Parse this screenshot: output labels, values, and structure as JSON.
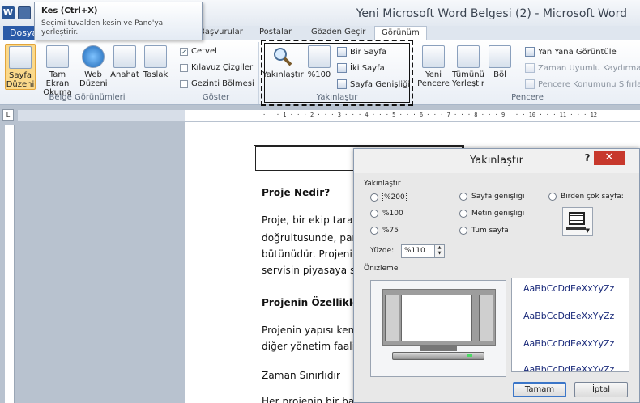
{
  "window": {
    "title": "Yeni Microsoft Word Belgesi (2)  -  Microsoft Word"
  },
  "tooltip": {
    "title": "Kes (Ctrl+X)",
    "body": "Seçimi tuvalden kesin ve Pano'ya yerleştirir."
  },
  "tabs": {
    "file": "Dosya",
    "items": [
      "Başvurular",
      "Postalar",
      "Gözden Geçir",
      "Görünüm"
    ],
    "active": "Görünüm"
  },
  "ribbon": {
    "belge_gorunumleri": {
      "label": "Belge Görünümleri",
      "buttons": [
        {
          "l1": "Sayfa",
          "l2": "Düzeni",
          "icon": "page-layout-icon"
        },
        {
          "l1": "Tam Ekran",
          "l2": "Okuma",
          "icon": "full-screen-reading-icon"
        },
        {
          "l1": "Web",
          "l2": "Düzeni",
          "icon": "web-layout-icon"
        },
        {
          "l1": "Anahat",
          "l2": "",
          "icon": "outline-icon"
        },
        {
          "l1": "Taslak",
          "l2": "",
          "icon": "draft-icon"
        }
      ]
    },
    "goster": {
      "label": "Göster",
      "items": [
        "Cetvel",
        "Kılavuz Çizgileri",
        "Gezinti Bölmesi"
      ],
      "checked": [
        true,
        false,
        false
      ]
    },
    "yakinlastir": {
      "label": "Yakınlaştır",
      "zoom": "Yakınlaştır",
      "percent": "%100",
      "one_page": "Bir Sayfa",
      "two_pages": "İki Sayfa",
      "page_width": "Sayfa Genişliği"
    },
    "pencere": {
      "label": "Pencere",
      "new_window": "Yeni Pencere",
      "arrange_all_1": "Tümünü",
      "arrange_all_2": "Yerleştir",
      "split": "Böl",
      "side_by_side": "Yan Yana Görüntüle",
      "sync_scroll": "Zaman Uyumlu Kaydırma",
      "reset_pos": "Pencere Konumunu Sıfırla"
    }
  },
  "ruler": {
    "ticks": "· · · 1 · · · 2 · · · 3 · · · 4 · · · 5 · · · 6 · · · 7 · · · 8 · · · 9 · · · 10 · · · 11 · · · 12"
  },
  "document": {
    "heading1": "Proje Nedir?",
    "line1": "Proje, bir ekip taraf",
    "line2": "doğrultusunde, par",
    "line3": "bütünüdür. Projeni",
    "line4": "servisin piyasaya sü",
    "heading2": "Projenin Özellikler",
    "line5": "Projenin yapısı kenc",
    "line6": "diğer yönetim faali",
    "line7": "Zaman Sınırlıdır",
    "line8": "Her projenin bir ba"
  },
  "dialog": {
    "title": "Yakınlaştır",
    "help": "?",
    "close": "✕",
    "group_label": "Yakınlaştır",
    "radios": {
      "p200": "%200",
      "p100": "%100",
      "p75": "%75",
      "page_width": "Sayfa genişliği",
      "text_width": "Metin genişliği",
      "whole_page": "Tüm sayfa",
      "many_pages": "Birden çok sayfa:"
    },
    "percent_label": "Yüzde:",
    "percent_value": "%110",
    "preview_label": "Önizleme",
    "sample_text": "AaBbCcDdEeXxYyZz",
    "ok": "Tamam",
    "cancel": "İptal"
  }
}
